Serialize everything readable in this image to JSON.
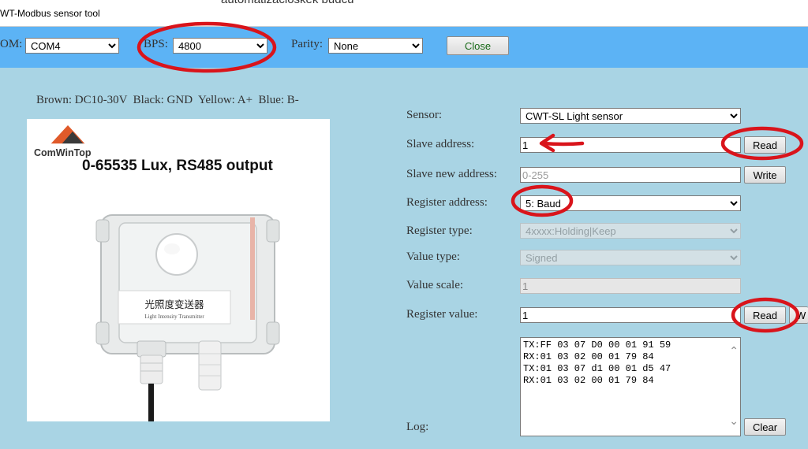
{
  "window": {
    "title": "WT-Modbus sensor tool",
    "background_text": "automatizacióskék budcu"
  },
  "toolbar": {
    "com_label": "OM:",
    "com_value": "COM4",
    "bps_label": "BPS:",
    "bps_value": "4800",
    "parity_label": "Parity:",
    "parity_value": "None",
    "close_label": "Close"
  },
  "left": {
    "wire_info": "Brown: DC10-30V  Black: GND  Yellow: A+  Blue: B-",
    "photo": {
      "brand": "ComWinTop",
      "headline": "0-65535 Lux, RS485 output",
      "device_label_cn": "光照度变送器",
      "device_label_en": "Light Intensity Transmitter"
    }
  },
  "form": {
    "sensor_label": "Sensor:",
    "sensor_value": "CWT-SL Light sensor",
    "slave_label": "Slave address:",
    "slave_value": "1",
    "slave_read": "Read",
    "slave_new_label": "Slave new address:",
    "slave_new_placeholder": "0-255",
    "slave_new_write": "Write",
    "register_address_label": "Register address:",
    "register_address_value": "5: Baud",
    "register_type_label": "Register type:",
    "register_type_value": "4xxxx:Holding|Keep",
    "value_type_label": "Value type:",
    "value_type_value": "Signed",
    "value_scale_label": "Value scale:",
    "value_scale_value": "1",
    "register_value_label": "Register value:",
    "register_value_value": "1",
    "register_value_read": "Read",
    "register_value_write": "W",
    "log_label": "Log:",
    "log_lines": [
      "TX:FF 03 07 D0 00 01 91 59",
      "RX:01 03 02 00 01 79 84",
      "TX:01 03 07 d1 00 01 d5 47",
      "RX:01 03 02 00 01 79 84"
    ],
    "clear_label": "Clear"
  },
  "colors": {
    "toolbar": "#5cb3f5",
    "panel": "#a9d4e4",
    "annotation": "#d9141b"
  }
}
